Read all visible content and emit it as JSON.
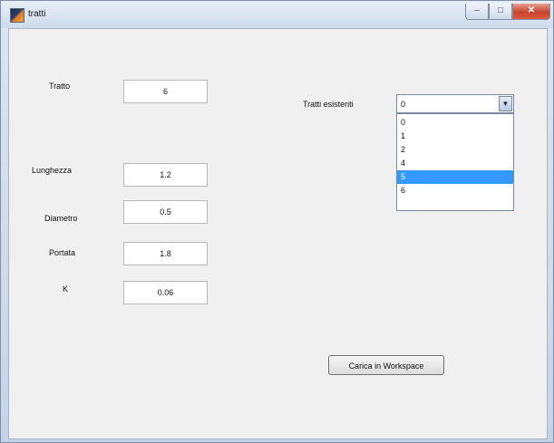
{
  "window": {
    "title": "tratti",
    "controls": {
      "minimize": "–",
      "maximize": "□",
      "close": "✕"
    }
  },
  "form": {
    "tratto": {
      "label": "Tratto",
      "value": "6"
    },
    "lunghezza": {
      "label": "Lunghezza",
      "value": "1.2"
    },
    "diametro": {
      "label": "Diametro",
      "value": "0.5"
    },
    "portata": {
      "label": "Portata",
      "value": "1.8"
    },
    "k": {
      "label": "K",
      "value": "0.06"
    }
  },
  "tratti_esistenti": {
    "label": "Tratti esistenti",
    "selected": "0",
    "arrow_icon": "▼",
    "options": [
      "0",
      "1",
      "2",
      "4",
      "5",
      "6"
    ],
    "highlighted": "5"
  },
  "actions": {
    "carica_label": "Carica in Workspace"
  }
}
